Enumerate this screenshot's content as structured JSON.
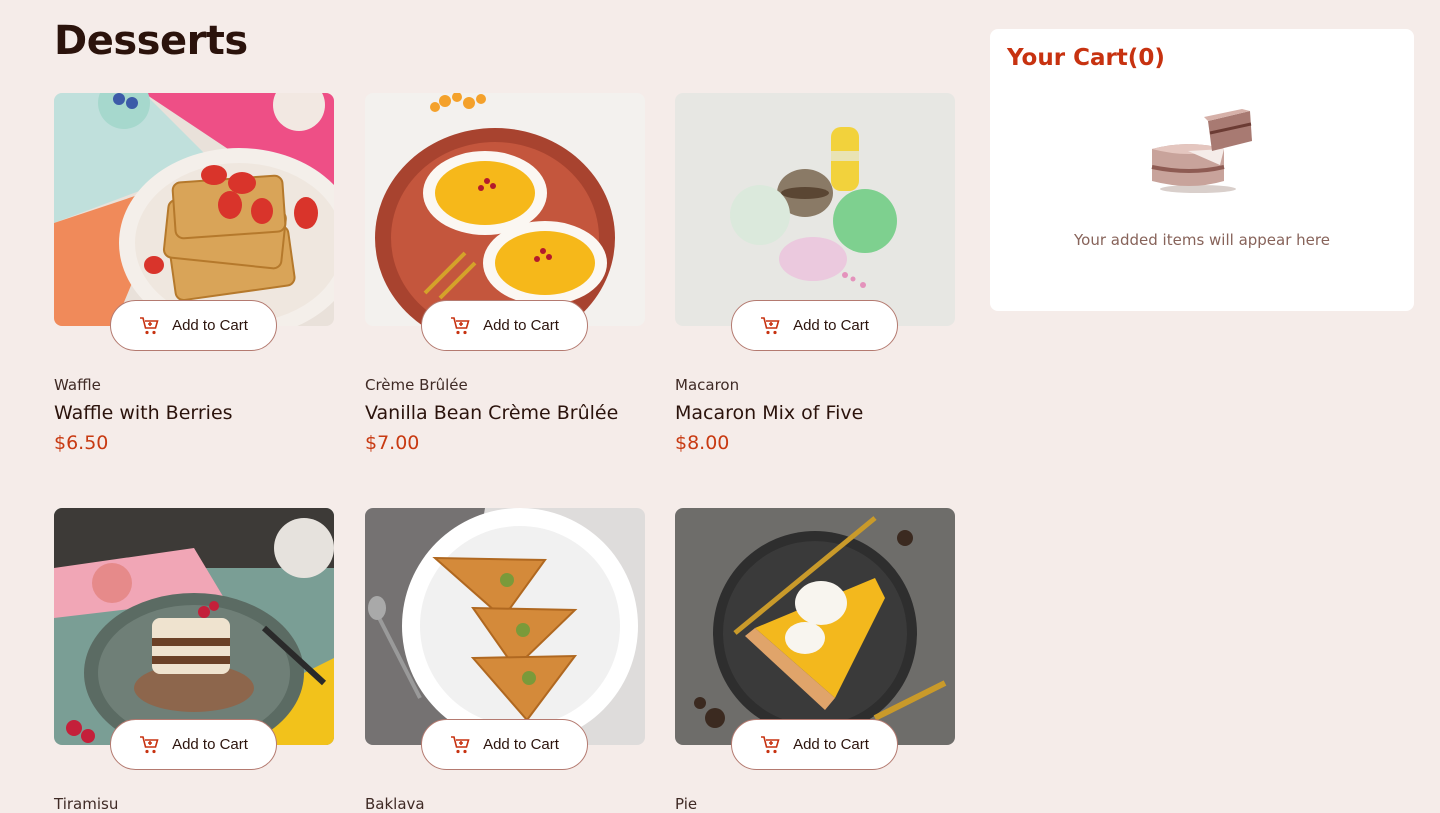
{
  "page": {
    "title": "Desserts"
  },
  "add_to_cart_label": "Add to Cart",
  "products": [
    {
      "category": "Waffle",
      "name": "Waffle with Berries",
      "price": "$6.50"
    },
    {
      "category": "Crème Brûlée",
      "name": "Vanilla Bean Crème Brûlée",
      "price": "$7.00"
    },
    {
      "category": "Macaron",
      "name": "Macaron Mix of Five",
      "price": "$8.00"
    },
    {
      "category": "Tiramisu",
      "name": "",
      "price": ""
    },
    {
      "category": "Baklava",
      "name": "",
      "price": ""
    },
    {
      "category": "Pie",
      "name": "",
      "price": ""
    }
  ],
  "cart": {
    "title": "Your Cart(0)",
    "empty_message": "Your added items will appear here",
    "illustration_icon": "empty-cake-icon"
  },
  "colors": {
    "accent": "#c73210",
    "background": "#f5ece9",
    "text": "#2b130c"
  }
}
